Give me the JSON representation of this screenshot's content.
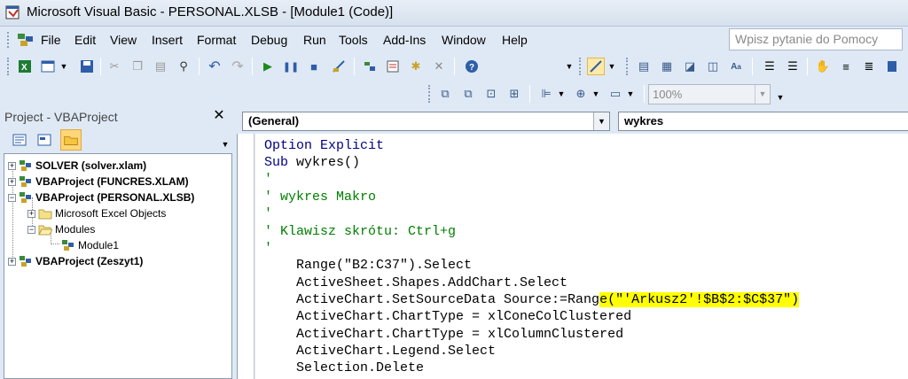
{
  "window": {
    "title": "Microsoft Visual Basic - PERSONAL.XLSB - [Module1 (Code)]"
  },
  "menu": [
    "File",
    "Edit",
    "View",
    "Insert",
    "Format",
    "Debug",
    "Run",
    "Tools",
    "Add-Ins",
    "Window",
    "Help"
  ],
  "help_box": {
    "placeholder": "Wpisz pytanie do Pomocy"
  },
  "toolbar": {
    "zoom": "100%"
  },
  "project": {
    "title": "Project - VBAProject",
    "close": "✕",
    "tree": [
      {
        "label": "SOLVER (solver.xlam)",
        "bold": true
      },
      {
        "label": "VBAProject (FUNCRES.XLAM)",
        "bold": true
      },
      {
        "label": "VBAProject (PERSONAL.XLSB)",
        "bold": true
      },
      {
        "label": "Microsoft Excel Objects",
        "bold": false
      },
      {
        "label": "Modules",
        "bold": false
      },
      {
        "label": "Module1",
        "bold": false
      },
      {
        "label": "VBAProject (Zeszyt1)",
        "bold": true
      }
    ]
  },
  "code": {
    "object_combo": "(General)",
    "proc_combo": "wykres",
    "lines": {
      "l1a": "Option ",
      "l1b": "Explicit",
      "l2a": "Sub ",
      "l2b": "wykres()",
      "l3": "'",
      "l4": "' wykres Makro",
      "l5": "'",
      "l6": "' Klawisz skrótu: Ctrl+g",
      "l7": "'",
      "l8": "    Range(\"B2:C37\").Select",
      "l9": "    ActiveSheet.Shapes.AddChart.Select",
      "l10a": "    ActiveChart.SetSourceData Source:=Rang",
      "l10b": "e(\"'Arkusz2'!$B$2:$C$37\")",
      "l11": "    ActiveChart.ChartType = xlConeColClustered",
      "l12": "    ActiveChart.ChartType = xlColumnClustered",
      "l13": "    ActiveChart.Legend.Select",
      "l14": "    Selection.Delete"
    }
  },
  "colors": {
    "keyword": "#000080",
    "comment": "#008000",
    "highlight": "#ffff00"
  }
}
